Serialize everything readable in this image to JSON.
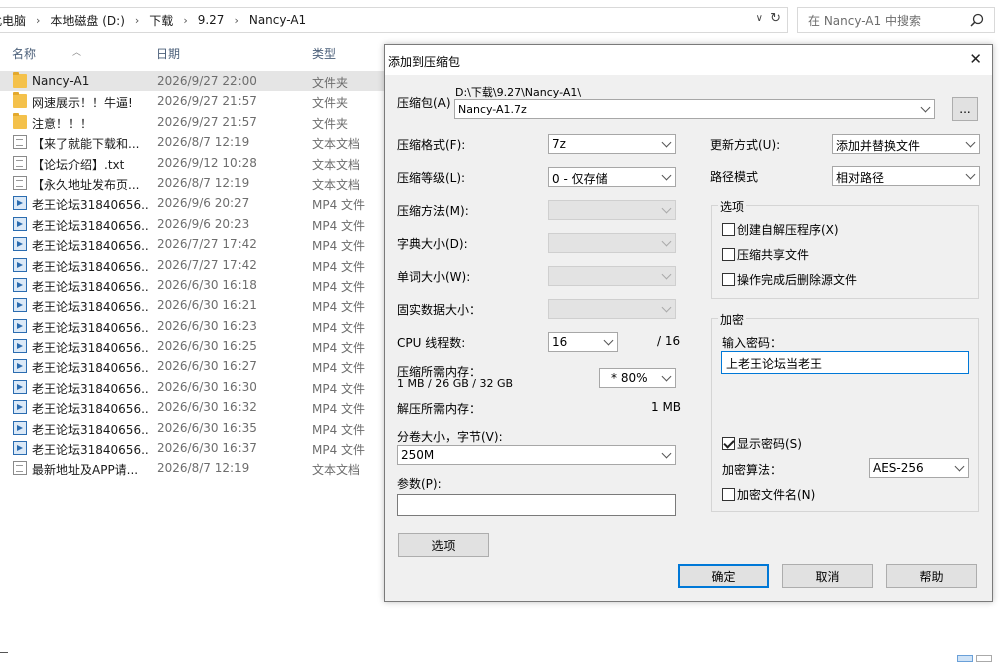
{
  "explorer": {
    "breadcrumb": [
      "此电脑",
      "本地磁盘 (D:)",
      "下载",
      "9.27",
      "Nancy-A1"
    ],
    "search_placeholder": "在 Nancy-A1 中搜索",
    "columns": {
      "name": "名称",
      "date": "日期",
      "type": "类型"
    },
    "files": [
      {
        "name": "Nancy-A1",
        "date": "2026/9/27 22:00",
        "type": "文件夹",
        "icon": "folder-icon",
        "selected": true
      },
      {
        "name": "网速展示！！牛逼!",
        "date": "2026/9/27 21:57",
        "type": "文件夹",
        "icon": "folder-icon"
      },
      {
        "name": "注意！！！",
        "date": "2026/9/27 21:57",
        "type": "文件夹",
        "icon": "folder-icon"
      },
      {
        "name": "【来了就能下载和...",
        "date": "2026/8/7 12:19",
        "type": "文本文档",
        "icon": "text-file-icon"
      },
      {
        "name": "【论坛介绍】.txt",
        "date": "2026/9/12 10:28",
        "type": "文本文档",
        "icon": "text-file-icon"
      },
      {
        "name": "【永久地址发布页...",
        "date": "2026/8/7 12:19",
        "type": "文本文档",
        "icon": "text-file-icon"
      },
      {
        "name": "老王论坛31840656...",
        "date": "2026/9/6 20:27",
        "type": "MP4 文件",
        "icon": "video-file-icon"
      },
      {
        "name": "老王论坛31840656...",
        "date": "2026/9/6 20:23",
        "type": "MP4 文件",
        "icon": "video-file-icon"
      },
      {
        "name": "老王论坛31840656...",
        "date": "2026/7/27 17:42",
        "type": "MP4 文件",
        "icon": "video-file-icon"
      },
      {
        "name": "老王论坛31840656...",
        "date": "2026/7/27 17:42",
        "type": "MP4 文件",
        "icon": "video-file-icon"
      },
      {
        "name": "老王论坛31840656...",
        "date": "2026/6/30 16:18",
        "type": "MP4 文件",
        "icon": "video-file-icon"
      },
      {
        "name": "老王论坛31840656...",
        "date": "2026/6/30 16:21",
        "type": "MP4 文件",
        "icon": "video-file-icon"
      },
      {
        "name": "老王论坛31840656...",
        "date": "2026/6/30 16:23",
        "type": "MP4 文件",
        "icon": "video-file-icon"
      },
      {
        "name": "老王论坛31840656...",
        "date": "2026/6/30 16:25",
        "type": "MP4 文件",
        "icon": "video-file-icon"
      },
      {
        "name": "老王论坛31840656...",
        "date": "2026/6/30 16:27",
        "type": "MP4 文件",
        "icon": "video-file-icon"
      },
      {
        "name": "老王论坛31840656...",
        "date": "2026/6/30 16:30",
        "type": "MP4 文件",
        "icon": "video-file-icon"
      },
      {
        "name": "老王论坛31840656...",
        "date": "2026/6/30 16:32",
        "type": "MP4 文件",
        "icon": "video-file-icon"
      },
      {
        "name": "老王论坛31840656...",
        "date": "2026/6/30 16:35",
        "type": "MP4 文件",
        "icon": "video-file-icon"
      },
      {
        "name": "老王论坛31840656...",
        "date": "2026/6/30 16:37",
        "type": "MP4 文件",
        "icon": "video-file-icon"
      },
      {
        "name": "最新地址及APP请...",
        "date": "2026/8/7 12:19",
        "type": "文本文档",
        "icon": "text-file-icon"
      }
    ]
  },
  "dialog": {
    "title": "添加到压缩包",
    "archive_label": "压缩包(A)",
    "archive_path": "D:\\下载\\9.27\\Nancy-A1\\",
    "archive_name": "Nancy-A1.7z",
    "browse_label": "...",
    "format_label": "压缩格式(F):",
    "format_value": "7z",
    "level_label": "压缩等级(L):",
    "level_value": "0 - 仅存储",
    "method_label": "压缩方法(M):",
    "dict_label": "字典大小(D):",
    "word_label": "单词大小(W):",
    "solid_label": "固实数据大小：",
    "cpu_label": "CPU 线程数:",
    "cpu_value": "16",
    "cpu_max": "/ 16",
    "mem_label": "压缩所需内存：",
    "mem_detail": "1 MB / 26 GB / 32 GB",
    "mem_pct": "* 80%",
    "decomp_label": "解压所需内存：",
    "decomp_value": "1 MB",
    "split_label": "分卷大小，字节(V):",
    "split_value": "250M",
    "params_label": "参数(P):",
    "params_value": "",
    "options_button": "选项",
    "update_label": "更新方式(U):",
    "update_value": "添加并替换文件",
    "pathmode_label": "路径模式",
    "pathmode_value": "相对路径",
    "options_group": "选项",
    "opt_sfx": "创建自解压程序(X)",
    "opt_shared": "压缩共享文件",
    "opt_delete": "操作完成后删除源文件",
    "enc_group": "加密",
    "pwd_label": "输入密码：",
    "pwd_value": "上老王论坛当老王",
    "show_pwd": "显示密码(S)",
    "algo_label": "加密算法：",
    "algo_value": "AES-256",
    "enc_names": "加密文件名(N)",
    "ok": "确定",
    "cancel": "取消",
    "help": "帮助"
  }
}
